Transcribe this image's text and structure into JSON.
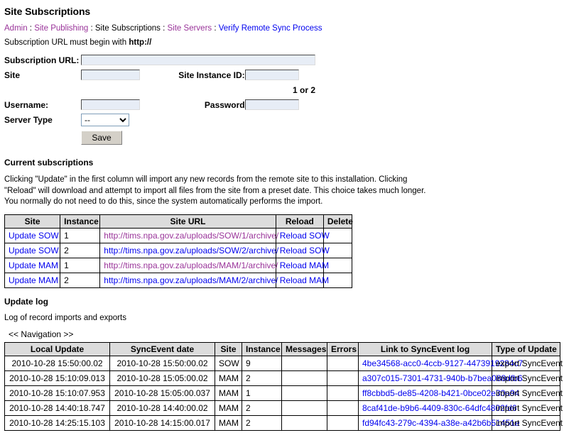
{
  "page": {
    "title": "Site Subscriptions"
  },
  "breadcrumb": {
    "separator": " : ",
    "items": [
      {
        "label": "Admin",
        "state": "visited"
      },
      {
        "label": "Site Publishing",
        "state": "visited"
      },
      {
        "label": "Site Subscriptions",
        "state": "current"
      },
      {
        "label": "Site Servers",
        "state": "visited"
      },
      {
        "label": "Verify Remote Sync Process",
        "state": "link"
      }
    ]
  },
  "intro": {
    "text_before": "Subscription URL must begin with ",
    "protocol": "http://"
  },
  "form": {
    "url_label": "Subscription URL:",
    "url_value": "",
    "url_placeholder": "",
    "site_label": "Site",
    "site_value": "",
    "instance_label": "Site Instance ID:",
    "instance_value": "",
    "instance_hint": "1 or 2",
    "username_label": "Username:",
    "username_value": "",
    "password_label": "Password",
    "password_value": "",
    "server_type_label": "Server Type",
    "server_type_selected": "--",
    "server_type_options": [
      "--"
    ],
    "save_label": "Save"
  },
  "subscriptions": {
    "heading": "Current subscriptions",
    "description": "Clicking \"Update\" in the first column will import any new records from the remote site to this installation. Clicking \"Reload\" will download and attempt to import all files from the site from a preset date. This choice takes much longer. You normally do not need to do this, since the system automatically performs the import.",
    "columns": [
      "Site",
      "Instance",
      "Site URL",
      "Reload",
      "Delete"
    ],
    "rows": [
      {
        "site": "Update SOW",
        "site_state": "link",
        "instance": "1",
        "url": "http://tims.npa.gov.za/uploads/SOW/1/archive/",
        "url_state": "visited",
        "reload": "Reload SOW",
        "delete": ""
      },
      {
        "site": "Update SOW",
        "site_state": "link",
        "instance": "2",
        "url": "http://tims.npa.gov.za/uploads/SOW/2/archive/",
        "url_state": "link",
        "reload": "Reload SOW",
        "delete": ""
      },
      {
        "site": "Update MAM",
        "site_state": "link",
        "instance": "1",
        "url": "http://tims.npa.gov.za/uploads/MAM/1/archive/",
        "url_state": "visited",
        "reload": "Reload MAM",
        "delete": ""
      },
      {
        "site": "Update MAM",
        "site_state": "link",
        "instance": "2",
        "url": "http://tims.npa.gov.za/uploads/MAM/2/archive/",
        "url_state": "link",
        "reload": "Reload MAM",
        "delete": ""
      }
    ]
  },
  "update_log": {
    "heading": "Update log",
    "description": "Log of record imports and exports",
    "navigation": "<< Navigation >>",
    "columns": [
      "Local Update",
      "SyncEvent date",
      "Site",
      "Instance",
      "Messages",
      "Errors",
      "Link to SyncEvent log",
      "Type of Update"
    ],
    "rows": [
      {
        "local_update": "2010-10-28 15:50:00.02",
        "syncevent_date": "2010-10-28 15:50:00.02",
        "site": "SOW",
        "instance": "9",
        "messages": "",
        "errors": "",
        "link": "4be34568-acc0-4ccb-9127-4473919284c7",
        "type": "export SyncEvent"
      },
      {
        "local_update": "2010-10-28 15:10:09.013",
        "syncevent_date": "2010-10-28 15:05:00.02",
        "site": "MAM",
        "instance": "2",
        "messages": "",
        "errors": "",
        "link": "a307c015-7301-4731-940b-b7bea088dfb6",
        "type": "import SyncEvent"
      },
      {
        "local_update": "2010-10-28 15:10:07.953",
        "syncevent_date": "2010-10-28 15:05:00.037",
        "site": "MAM",
        "instance": "1",
        "messages": "",
        "errors": "",
        "link": "ff8cbbd5-de85-4208-b421-0bce02e30a94",
        "type": "import SyncEvent"
      },
      {
        "local_update": "2010-10-28 14:40:18.747",
        "syncevent_date": "2010-10-28 14:40:00.02",
        "site": "MAM",
        "instance": "2",
        "messages": "",
        "errors": "",
        "link": "8caf41de-b9b6-4409-830c-64dfc4802fd6",
        "type": "import SyncEvent"
      },
      {
        "local_update": "2010-10-28 14:25:15.103",
        "syncevent_date": "2010-10-28 14:15:00.017",
        "site": "MAM",
        "instance": "2",
        "messages": "",
        "errors": "",
        "link": "fd94fc43-279c-4394-a38e-a42b6b51451e",
        "type": "import SyncEvent"
      }
    ]
  },
  "colors": {
    "link": "#0000ee",
    "visited": "#993399",
    "header_bg": "#dcdcdc",
    "input_bg": "#e7edf6"
  }
}
